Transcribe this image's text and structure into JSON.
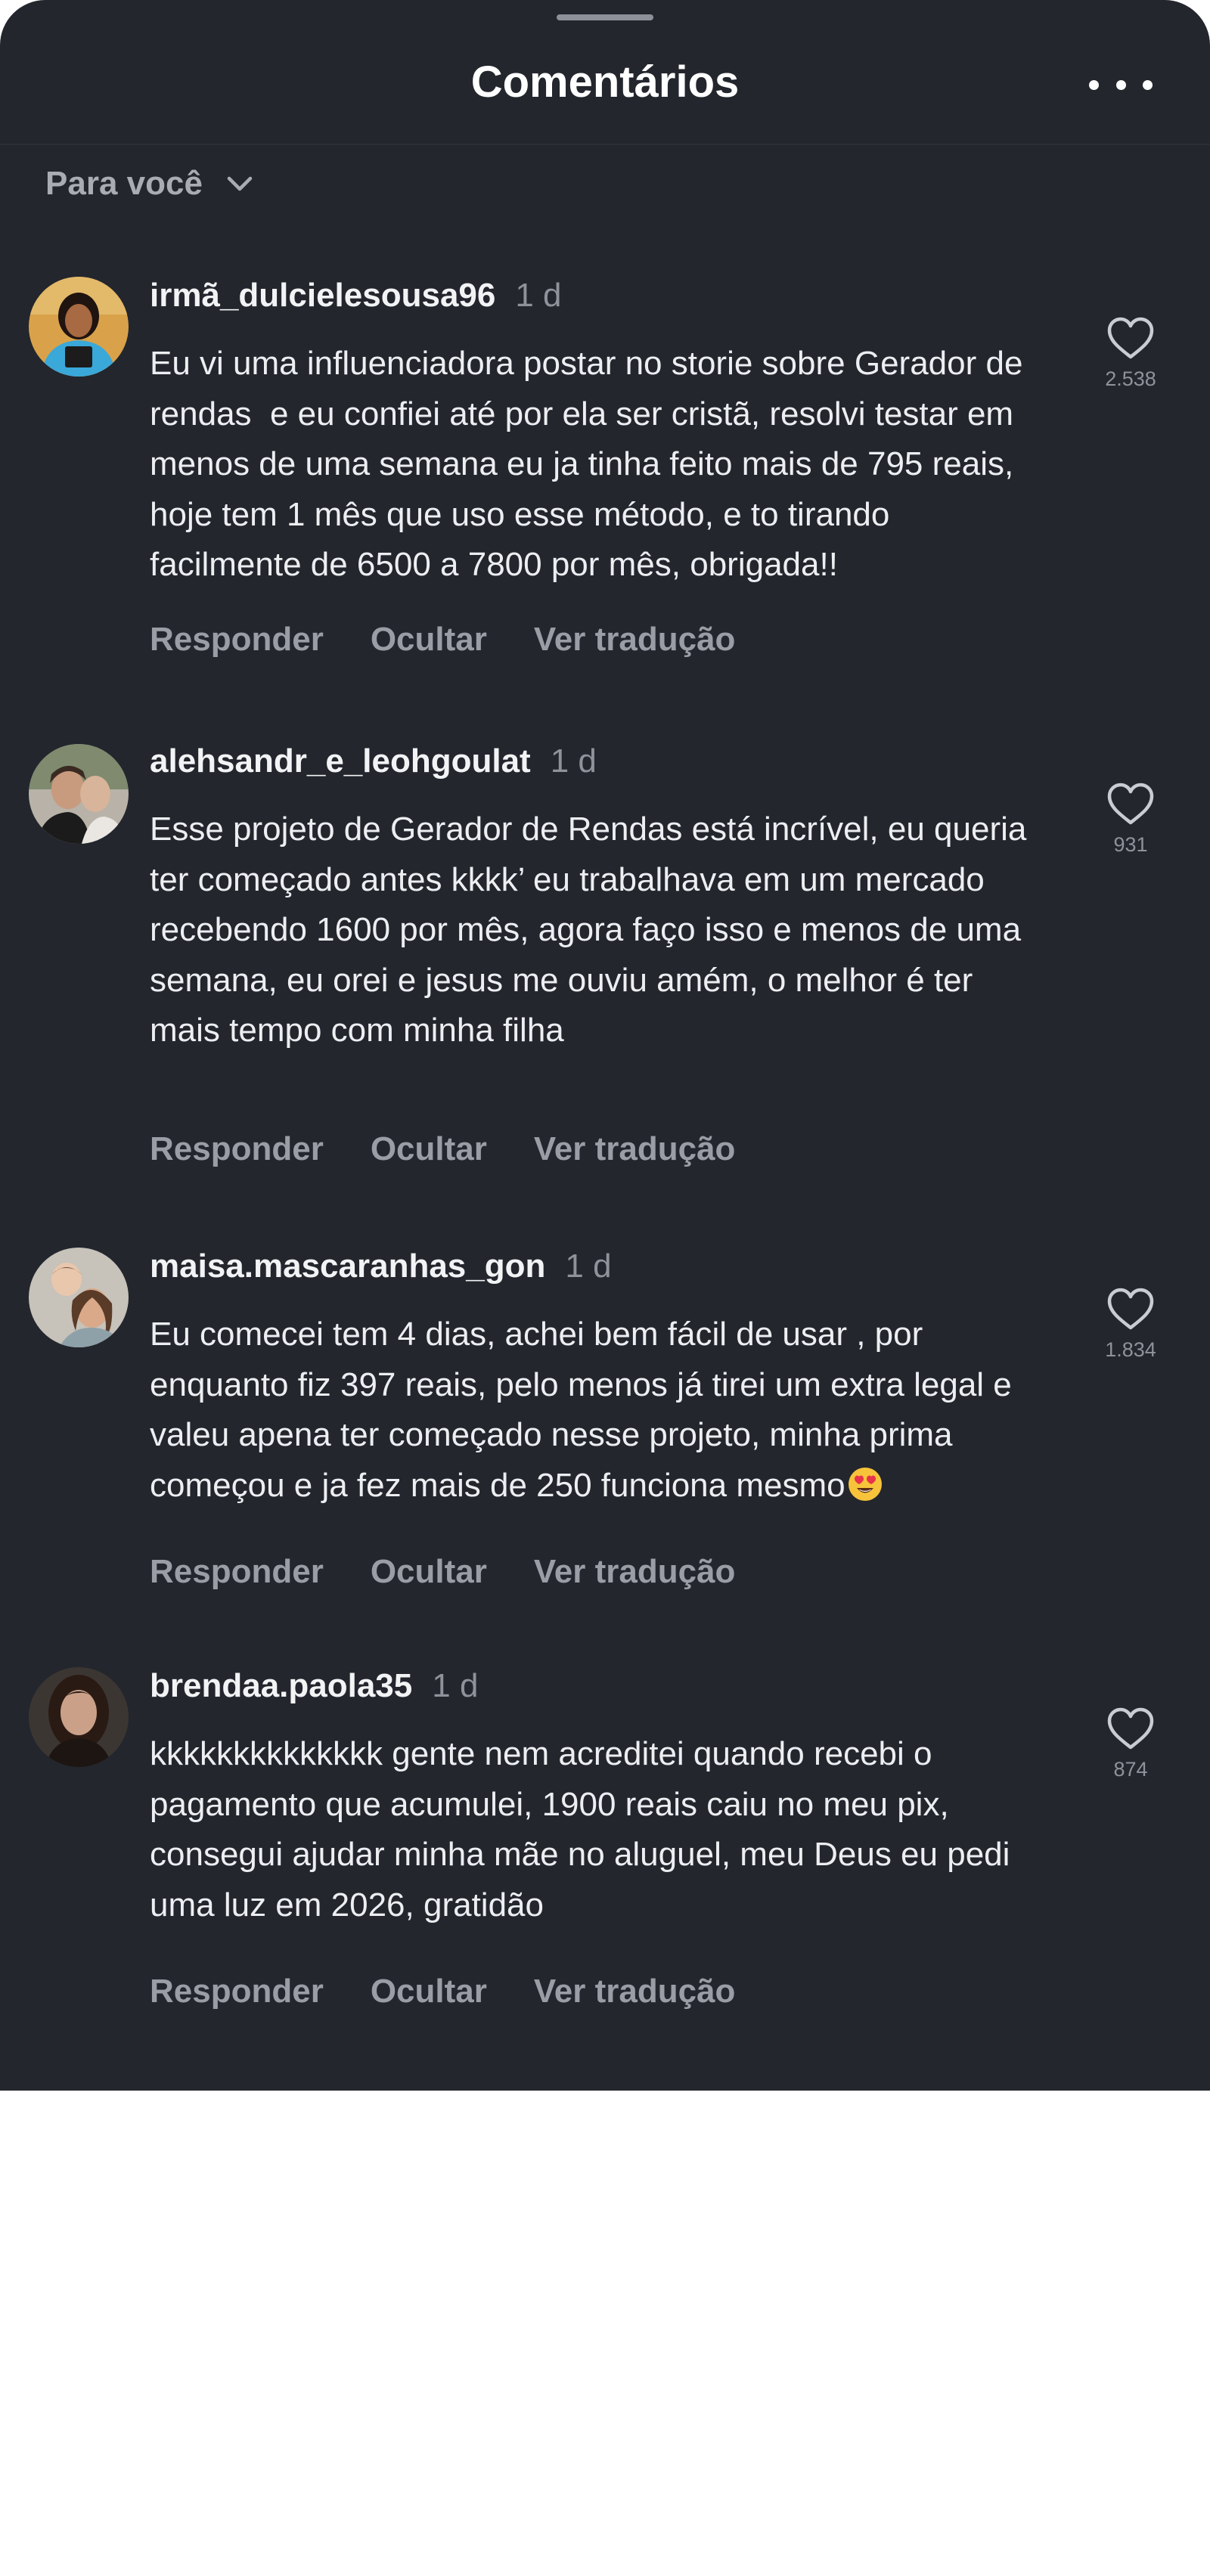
{
  "header": {
    "title": "Comentários",
    "more_icon": "more-horizontal-icon"
  },
  "filter": {
    "label": "Para você",
    "icon": "chevron-down-icon"
  },
  "comments": [
    {
      "username": "irmã_dulcielesousa96",
      "time": "1 d",
      "text": "Eu vi uma influenciadora postar no storie sobre Gerador de rendas  e eu confiei até por ela ser cristã, resolvi testar em menos de uma semana eu ja tinha feito mais de 795 reais, hoje tem 1 mês que uso esse método, e to tirando facilmente de 6500 a 7800 por mês, obrigada!!",
      "likes": "2.538",
      "reply": "Responder",
      "hide": "Ocultar",
      "translate": "Ver tradução"
    },
    {
      "username": "alehsandr_e_leohgoulat",
      "time": "1 d",
      "text": "Esse projeto de Gerador de Rendas está incrível, eu queria ter começado antes kkkk’ eu trabalhava em um mercado recebendo 1600 por mês, agora faço isso e menos de uma semana, eu orei e jesus me ouviu amém, o melhor é ter mais tempo com minha filha",
      "likes": "931",
      "reply": "Responder",
      "hide": "Ocultar",
      "translate": "Ver tradução"
    },
    {
      "username": "maisa.mascaranhas_gon",
      "time": "1 d",
      "text": "Eu comecei tem 4 dias, achei bem fácil de usar , por enquanto fiz 397 reais, pelo menos já tirei um extra legal e valeu apena ter começado nesse projeto, minha prima começou e ja fez mais de 250 funciona mesmo",
      "emoji": "heart-eyes-emoji",
      "likes": "1.834",
      "reply": "Responder",
      "hide": "Ocultar",
      "translate": "Ver tradução"
    },
    {
      "username": "brendaa.paola35",
      "time": "1 d",
      "text": "kkkkkkkkkkkkkk gente nem acreditei quando recebi o pagamento que acumulei, 1900 reais caiu no meu pix, consegui ajudar minha mãe no aluguel, meu Deus eu pedi uma luz em 2026, gratidão",
      "likes": "874",
      "reply": "Responder",
      "hide": "Ocultar",
      "translate": "Ver tradução"
    }
  ],
  "colors": {
    "sheet_background": "#23262d",
    "page_background": "#ffffff",
    "primary_text": "#eceef1",
    "secondary_text": "#8f929a"
  }
}
